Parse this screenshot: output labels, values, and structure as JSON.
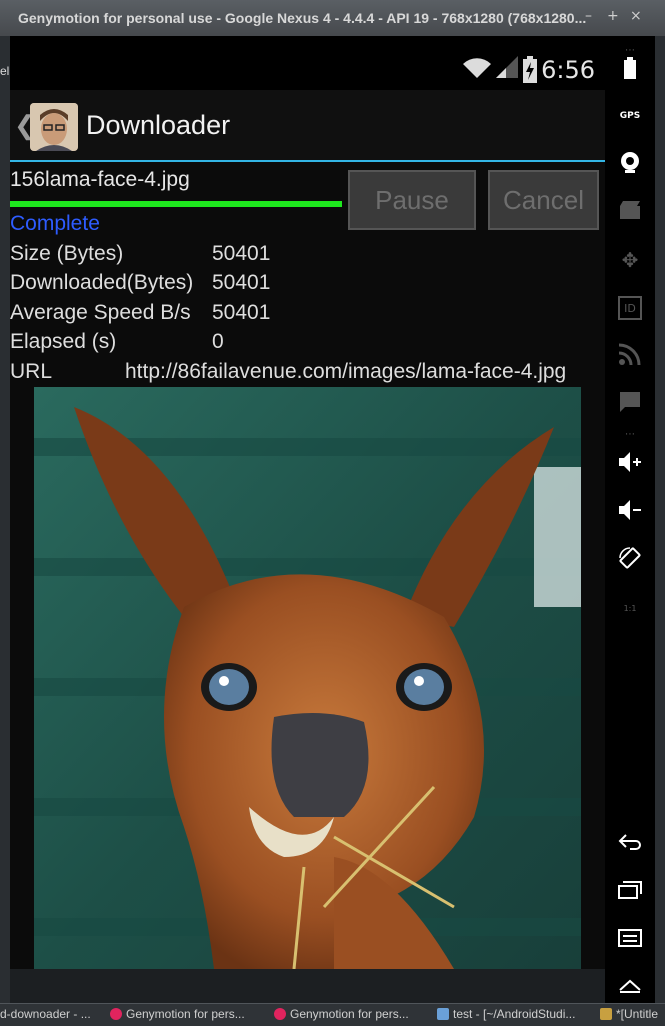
{
  "window": {
    "title": "Genymotion for personal use - Google Nexus 4 - 4.4.4 - API 19 - 768x1280 (768x1280...",
    "minimize": "–",
    "maximize": "+",
    "close": "×"
  },
  "status_bar": {
    "time": "6:56"
  },
  "action_bar": {
    "back_glyph": "❮",
    "title": "Downloader"
  },
  "download": {
    "filename": "156lama-face-4.jpg",
    "progress_fraction": 1.0,
    "pause_label": "Pause",
    "cancel_label": "Cancel",
    "status": "Complete",
    "rows": [
      {
        "label": "Size (Bytes)",
        "value": "50401"
      },
      {
        "label": "Downloaded(Bytes)",
        "value": "50401"
      },
      {
        "label": "Average Speed B/s",
        "value": "50401"
      },
      {
        "label": "Elapsed (s)",
        "value": "0"
      },
      {
        "label": "URL",
        "value": "http://86failavenue.com/images/lama-face-4.jpg"
      }
    ]
  },
  "sidebar": {
    "gps_label": "GPS",
    "id_label": "ID",
    "scale_label": "1:1"
  },
  "taskbar": {
    "items": [
      {
        "label": "d-downoader - ...",
        "icon": "app-icon",
        "color": "#888888"
      },
      {
        "label": "Genymotion for pers...",
        "icon": "genymotion-icon",
        "color": "#e0245e"
      },
      {
        "label": "Genymotion for pers...",
        "icon": "genymotion-icon",
        "color": "#e0245e"
      },
      {
        "label": "test - [~/AndroidStudi...",
        "icon": "android-studio-icon",
        "color": "#6aa0d8"
      },
      {
        "label": "*[Untitle",
        "icon": "gimp-icon",
        "color": "#c8a040"
      }
    ]
  },
  "left_edge_label": "el",
  "colors": {
    "accent": "#33b5e5",
    "progress": "#1ee81e",
    "status": "#2e5cff"
  }
}
